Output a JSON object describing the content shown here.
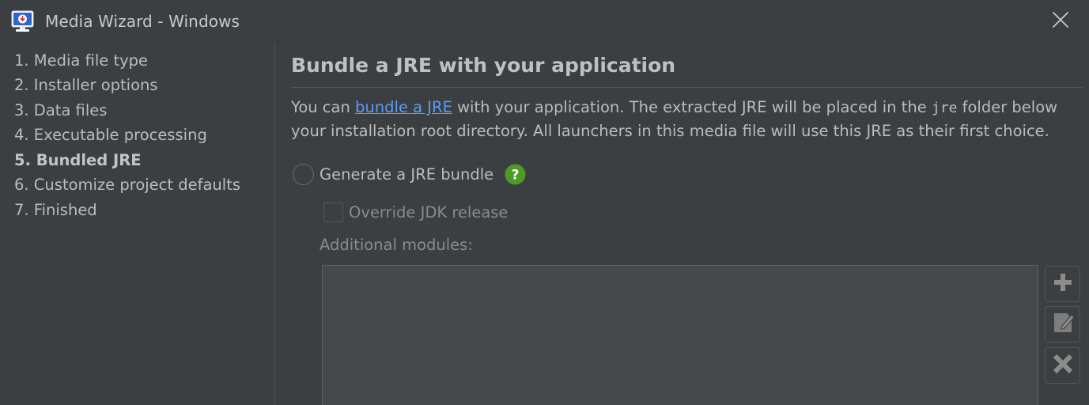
{
  "window": {
    "title": "Media Wizard - Windows",
    "app_icon": "media-monitor-icon",
    "close_icon": "close-icon"
  },
  "sidebar": {
    "steps": [
      {
        "label": "1. Media file type",
        "active": false
      },
      {
        "label": "2. Installer options",
        "active": false
      },
      {
        "label": "3. Data files",
        "active": false
      },
      {
        "label": "4. Executable processing",
        "active": false
      },
      {
        "label": "5. Bundled JRE",
        "active": true
      },
      {
        "label": "6. Customize project defaults",
        "active": false
      },
      {
        "label": "7. Finished",
        "active": false
      }
    ]
  },
  "main": {
    "heading": "Bundle a JRE with your application",
    "description": {
      "part1": "You can ",
      "link": "bundle a JRE",
      "part2": " with your application. The extracted JRE will be placed in the ",
      "code": "jre",
      "part3": " folder below your installation root directory. All launchers in this media file will use this JRE as their first choice."
    },
    "generate_radio": {
      "label": "Generate a JRE bundle",
      "selected": false,
      "help_icon": "help-icon"
    },
    "override_checkbox": {
      "label": "Override JDK release",
      "checked": false,
      "enabled": false
    },
    "modules": {
      "label": "Additional modules:",
      "items": [],
      "buttons": [
        {
          "icon": "add-icon"
        },
        {
          "icon": "edit-icon"
        },
        {
          "icon": "remove-icon"
        }
      ]
    }
  },
  "colors": {
    "background": "#3c3f41",
    "text": "#bbbbbb",
    "link": "#589df6",
    "disabled_text": "#8a8a8a",
    "help_green": "#4d9a26",
    "icon_blue": "#2f65ca"
  }
}
